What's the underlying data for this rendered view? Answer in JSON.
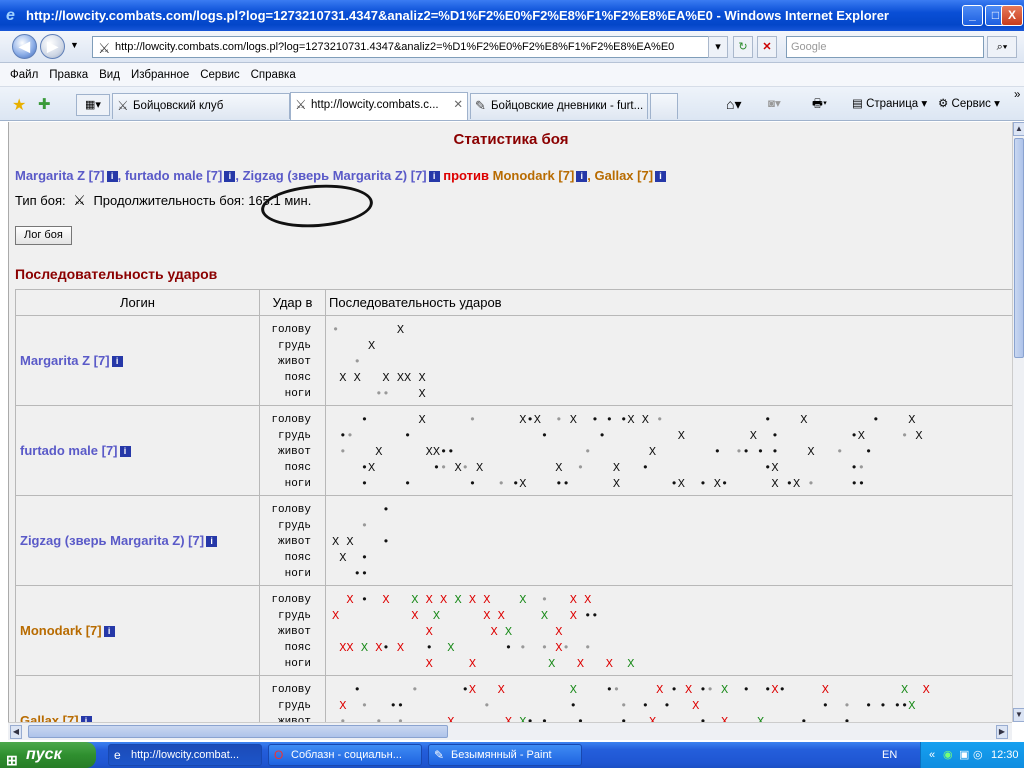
{
  "window": {
    "title": "http://lowcity.combats.com/logs.pl?log=1273210731.4347&analiz2=%D1%F2%E0%F2%E8%F1%F2%E8%EA%E0 - Windows Internet Explorer",
    "min": "_",
    "max": "□",
    "close": "X"
  },
  "address": {
    "url": "http://lowcity.combats.com/logs.pl?log=1273210731.4347&analiz2=%D1%F2%E0%F2%E8%F1%F2%E8%EA%E0",
    "search_placeholder": "Google"
  },
  "menu": [
    "Файл",
    "Правка",
    "Вид",
    "Избранное",
    "Сервис",
    "Справка"
  ],
  "tabs": [
    {
      "label": "Бойцовский клуб",
      "active": false
    },
    {
      "label": "http://lowcity.combats.c...",
      "active": true
    },
    {
      "label": "Бойцовские дневники - furt...",
      "active": false
    }
  ],
  "toolbar": {
    "page": "Страница",
    "service": "Сервис"
  },
  "page": {
    "title": "Статистика боя",
    "fighters_left": [
      {
        "name": "Margarita Z [7]"
      },
      {
        "name": "furtado male [7]"
      },
      {
        "name": "Zigzag (зверь Margarita Z) [7]"
      }
    ],
    "versus": "против",
    "fighters_right": [
      {
        "name": "Monodark [7]"
      },
      {
        "name": "Gallax [7]"
      }
    ],
    "type_label": "Тип боя:",
    "duration_label": "Продолжительность боя:",
    "duration_value": "165.1 мин.",
    "log_button": "Лог боя",
    "subtitle": "Последовательность ударов",
    "table": {
      "headers": [
        "Логин",
        "Удар в",
        "Последовательность ударов"
      ],
      "zones": [
        "голову",
        "грудь",
        "живот",
        "пояс",
        "ноги"
      ],
      "rows": [
        {
          "login": "Margarita Z [7]",
          "team": "b",
          "seq": [
            "·        X",
            "     X",
            "   ·",
            " X X   X XX X",
            "      ··    X"
          ]
        },
        {
          "login": "furtado male [7]",
          "team": "b",
          "seq": [
            "    •       X      ·      X•X  · X  • • •X X ·              •    X         •    X",
            " •·       •                  •       •          X         X  •          •X     · X",
            " ·    X      XX••                  ·        X        •  ·• • •    X   ·   •",
            "    •X        •· X· X          X  ·    X   •                •X          •·",
            "    •     •        •   · •X    ••      X       •X  • X•      X •X ·     ••"
          ]
        },
        {
          "login": "Zigzag (зверь Margarita Z) [7]",
          "team": "b",
          "seq": [
            "       •",
            "    ·",
            "X X    •",
            " X  •",
            "   ••"
          ]
        },
        {
          "login": "Monodark [7]",
          "team": "o",
          "seq": [
            "  X •  X   X X X X X X    X  ·   X X",
            "X          X  X      X X     X   X ••",
            "             X        X X      X",
            " XX X X• X   •  X       • ·  · X·  ·",
            "             X     X          X   X   X  X"
          ]
        },
        {
          "login": "Gallax [7]",
          "team": "o",
          "seq": [
            "   •       ·      •X   X         X    •·     X • X •· X  •  •X•     X          X  X",
            " X  ·   ••           ·           •      ·  •  •   X                 •  ·  • • ••X",
            " ·    ·  ·      X       X X• •    •     •   X      •  X    X     •     •"
          ]
        }
      ]
    }
  },
  "taskbar": {
    "start": "пуск",
    "items": [
      {
        "label": "http://lowcity.combat..."
      },
      {
        "label": "Соблазн - социальн..."
      },
      {
        "label": "Безымянный - Paint"
      }
    ],
    "lang": "EN",
    "clock": "12:30"
  }
}
